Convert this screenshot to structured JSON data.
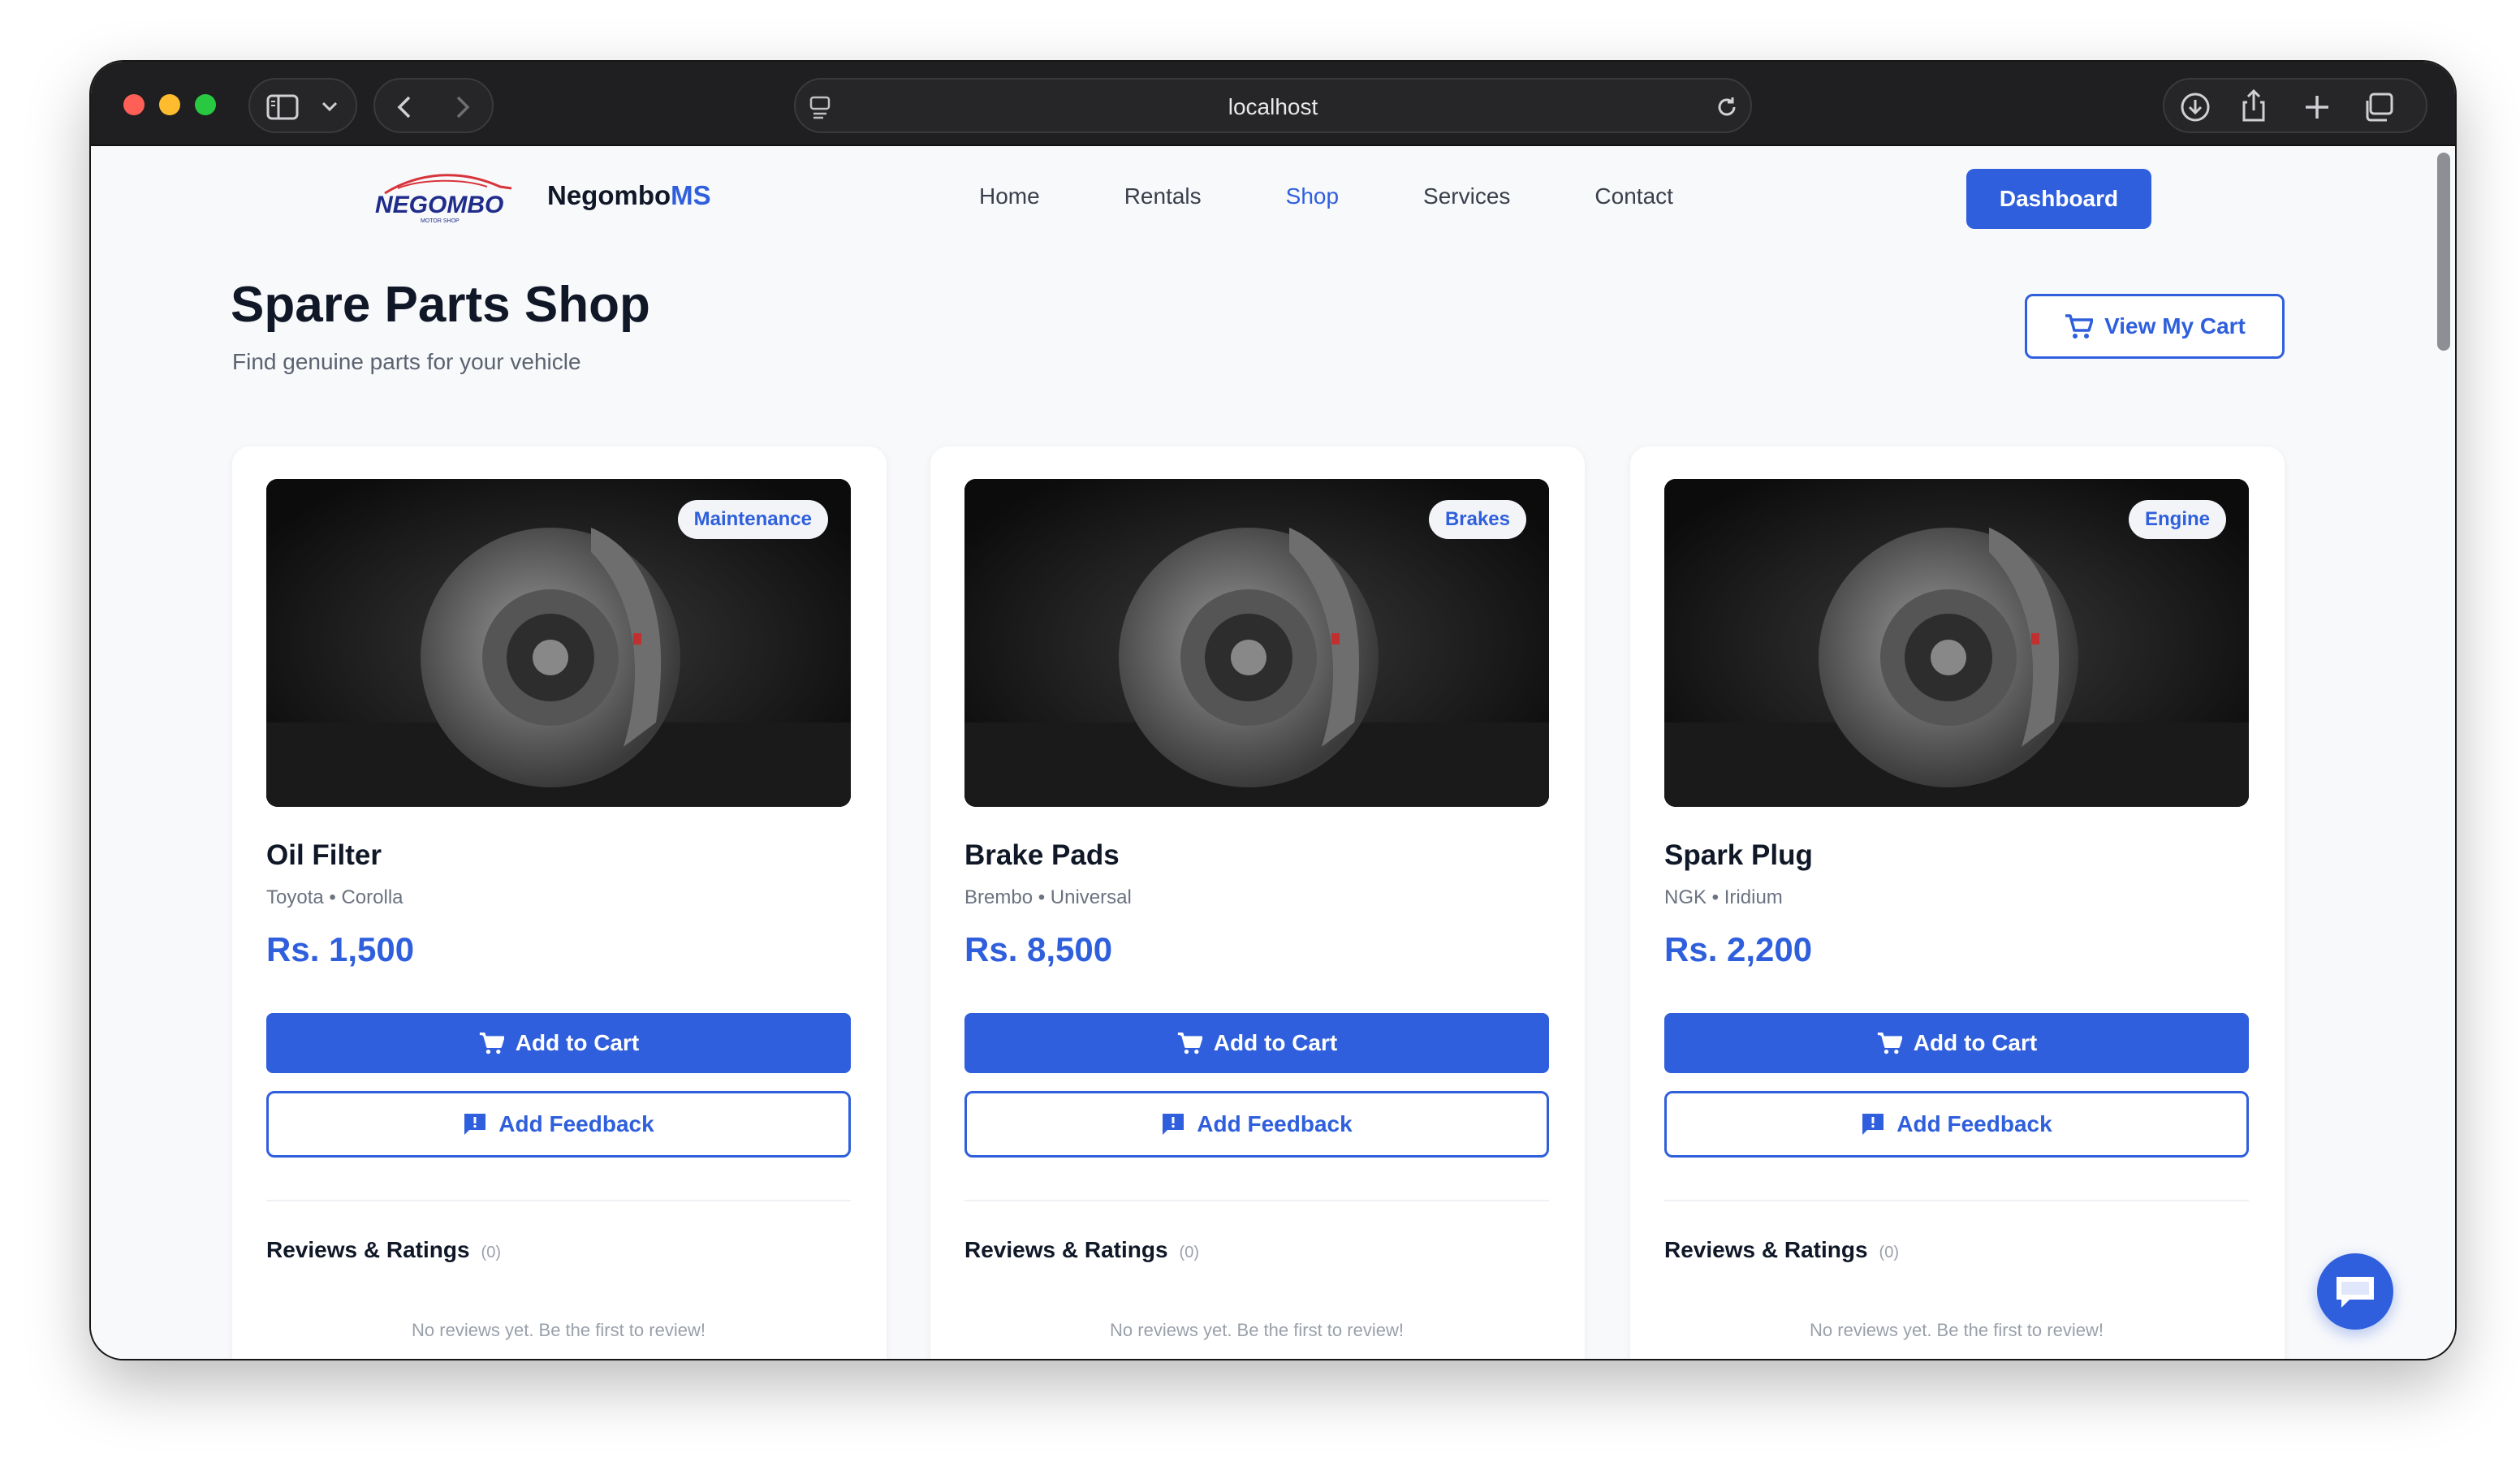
{
  "browser": {
    "url": "localhost"
  },
  "header": {
    "logo_text": "NEGOMBO",
    "logo_subtext": "MOTOR SHOP",
    "brand_main": "Negombo",
    "brand_accent": "MS",
    "nav": [
      {
        "label": "Home",
        "active": false
      },
      {
        "label": "Rentals",
        "active": false
      },
      {
        "label": "Shop",
        "active": true
      },
      {
        "label": "Services",
        "active": false
      },
      {
        "label": "Contact",
        "active": false
      }
    ],
    "dashboard_label": "Dashboard"
  },
  "page": {
    "title": "Spare Parts Shop",
    "subtitle": "Find genuine parts for your vehicle",
    "cart_label": "View My Cart"
  },
  "products": [
    {
      "category": "Maintenance",
      "name": "Oil Filter",
      "brand": "Toyota",
      "model": "Corolla",
      "price": "Rs. 1,500",
      "add_to_cart": "Add to Cart",
      "add_feedback": "Add Feedback",
      "reviews_title": "Reviews & Ratings",
      "reviews_count": "(0)",
      "no_reviews": "No reviews yet. Be the first to review!"
    },
    {
      "category": "Brakes",
      "name": "Brake Pads",
      "brand": "Brembo",
      "model": "Universal",
      "price": "Rs. 8,500",
      "add_to_cart": "Add to Cart",
      "add_feedback": "Add Feedback",
      "reviews_title": "Reviews & Ratings",
      "reviews_count": "(0)",
      "no_reviews": "No reviews yet. Be the first to review!"
    },
    {
      "category": "Engine",
      "name": "Spark Plug",
      "brand": "NGK",
      "model": "Iridium",
      "price": "Rs. 2,200",
      "add_to_cart": "Add to Cart",
      "add_feedback": "Add Feedback",
      "reviews_title": "Reviews & Ratings",
      "reviews_count": "(0)",
      "no_reviews": "No reviews yet. Be the first to review!"
    }
  ],
  "colors": {
    "accent": "#2f5fdc",
    "text": "#101828",
    "muted": "#6b7280",
    "background": "#f8f9fb"
  }
}
